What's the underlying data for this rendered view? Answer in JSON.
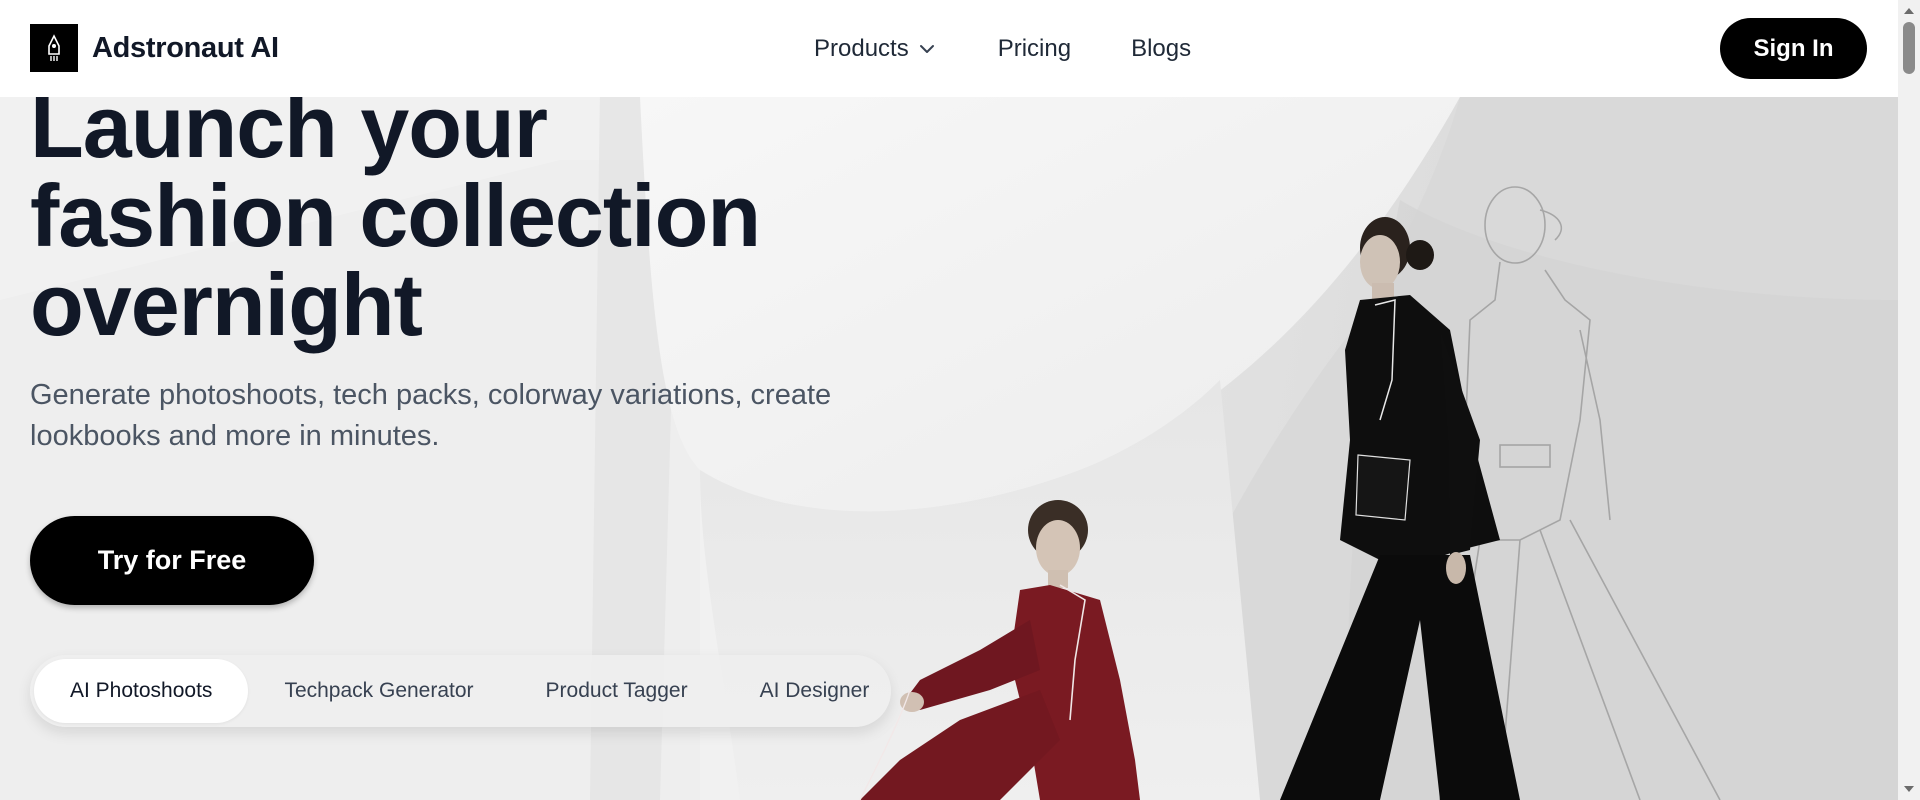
{
  "header": {
    "brand_name": "Adstronaut AI",
    "logo_icon": "rocket-logo-icon",
    "nav": {
      "products_label": "Products",
      "pricing_label": "Pricing",
      "blogs_label": "Blogs"
    },
    "signin_label": "Sign In"
  },
  "hero": {
    "headline_lines": [
      "Launch your",
      "fashion collection",
      "overnight"
    ],
    "subtext": "Generate photoshoots, tech packs, colorway variations, create lookbooks and more in minutes.",
    "cta_label": "Try for Free",
    "tabs": [
      {
        "label": "AI Photoshoots",
        "active": true
      },
      {
        "label": "Techpack Generator",
        "active": false
      },
      {
        "label": "Product Tagger",
        "active": false
      },
      {
        "label": "AI Designer",
        "active": false
      }
    ]
  },
  "colors": {
    "primary": "#000000",
    "heading": "#111827",
    "body_text": "#4b5563",
    "suit_red": "#7a1a22"
  }
}
